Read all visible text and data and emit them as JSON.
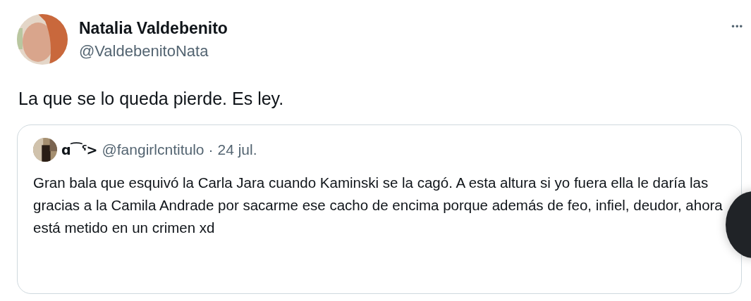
{
  "tweet": {
    "author": {
      "name": "Natalia Valdebenito",
      "handle": "@ValdebenitoNata"
    },
    "more": "•••",
    "text": "La que se lo queda pierde. Es ley.",
    "quote": {
      "author": {
        "name": "ɑ⁀ˤ>",
        "handle": "@fangirlcntitulo",
        "date": "24 jul."
      },
      "separator": "·",
      "text": "Gran bala que esquivó la Carla Jara cuando Kaminski se la cagó. A esta altura si yo fuera ella le daría las gracias a la Camila Andrade por sacarme ese cacho de encima porque además de feo, infiel, deudor, ahora está metido en un crimen xd"
    }
  }
}
